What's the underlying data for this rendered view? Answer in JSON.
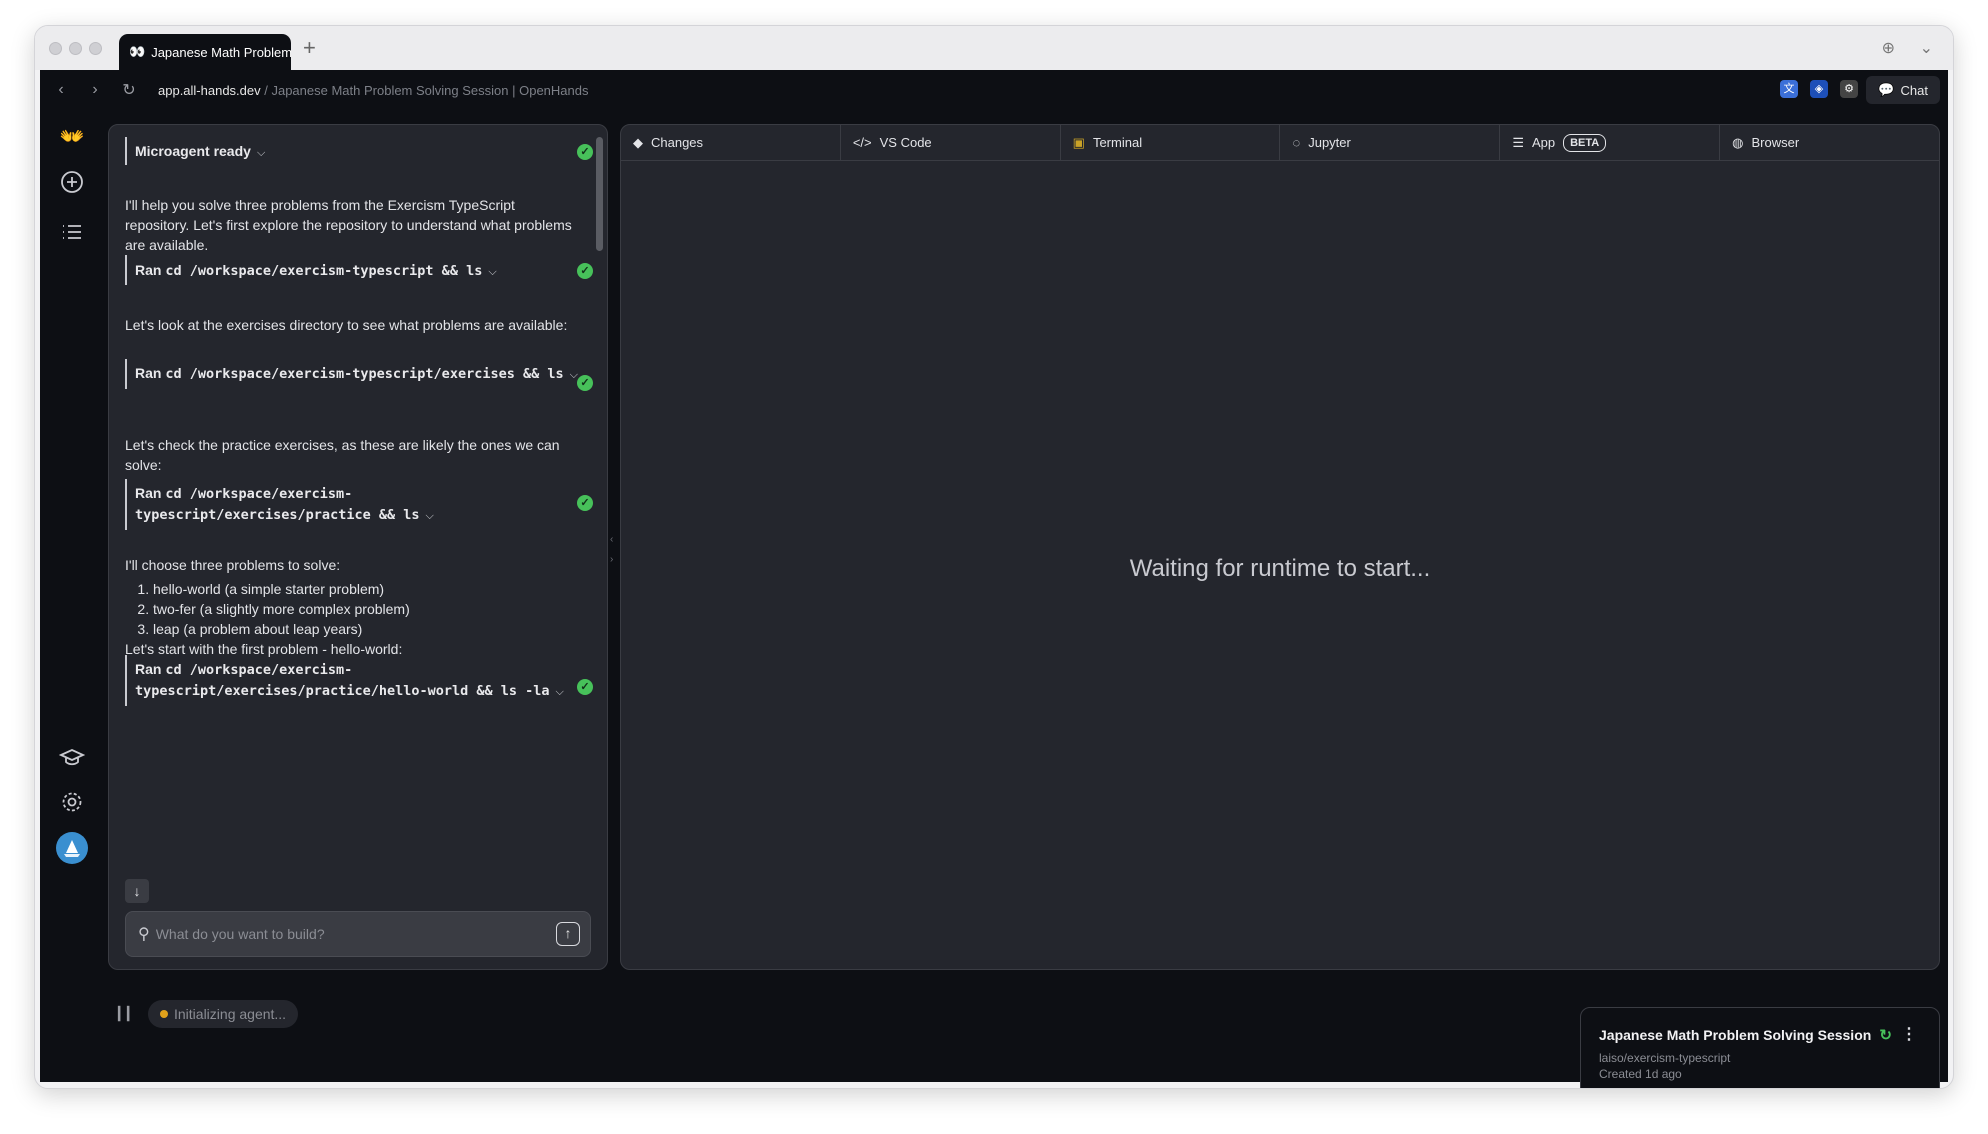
{
  "browser": {
    "tab_title": "Japanese Math Problem Solving Session | OpenHands",
    "tab_favicon": "👀",
    "url_host": "app.all-hands.dev",
    "url_path": " / Japanese Math Problem Solving Session | OpenHands",
    "chat_button": "Chat"
  },
  "rail": {
    "logo": "👐"
  },
  "chat": {
    "microagent": "Microagent ready",
    "messages": {
      "m1": "I'll help you solve three problems from the Exercism TypeScript repository. Let's first explore the repository to understand what problems are available.",
      "m2": "Let's look at the exercises directory to see what problems are available:",
      "m3": "Let's check the practice exercises, as these are likely the ones we can solve:",
      "m4_intro": "I'll choose three problems to solve:",
      "m4_items": [
        "hello-world (a simple starter problem)",
        "two-fer (a slightly more complex problem)",
        "leap (a problem about leap years)"
      ],
      "m4_outro": "Let's start with the first problem - hello-world:"
    },
    "commands": {
      "ran_label": "Ran",
      "c1": "cd /workspace/exercism-typescript && ls",
      "c2": "cd /workspace/exercism-typescript/exercises && ls",
      "c3": "cd /workspace/exercism-typescript/exercises/practice && ls",
      "c4": "cd /workspace/exercism-typescript/exercises/practice/hello-world && ls -la"
    },
    "input_placeholder": "What do you want to build?"
  },
  "workspace": {
    "tabs": {
      "changes": "Changes",
      "vscode": "VS Code",
      "terminal": "Terminal",
      "jupyter": "Jupyter",
      "app": "App",
      "app_badge": "BETA",
      "browser": "Browser"
    },
    "waiting": "Waiting for runtime to start..."
  },
  "status": {
    "agent_state": "Initializing agent..."
  },
  "conversation": {
    "title": "Japanese Math Problem Solving Session",
    "repo": "laiso/exercism-typescript",
    "created": "Created 1d ago"
  },
  "colors": {
    "accent_green": "#47c15a",
    "status_orange": "#e0a11b",
    "panel_bg": "#24262d",
    "app_bg": "#0d0f14"
  }
}
